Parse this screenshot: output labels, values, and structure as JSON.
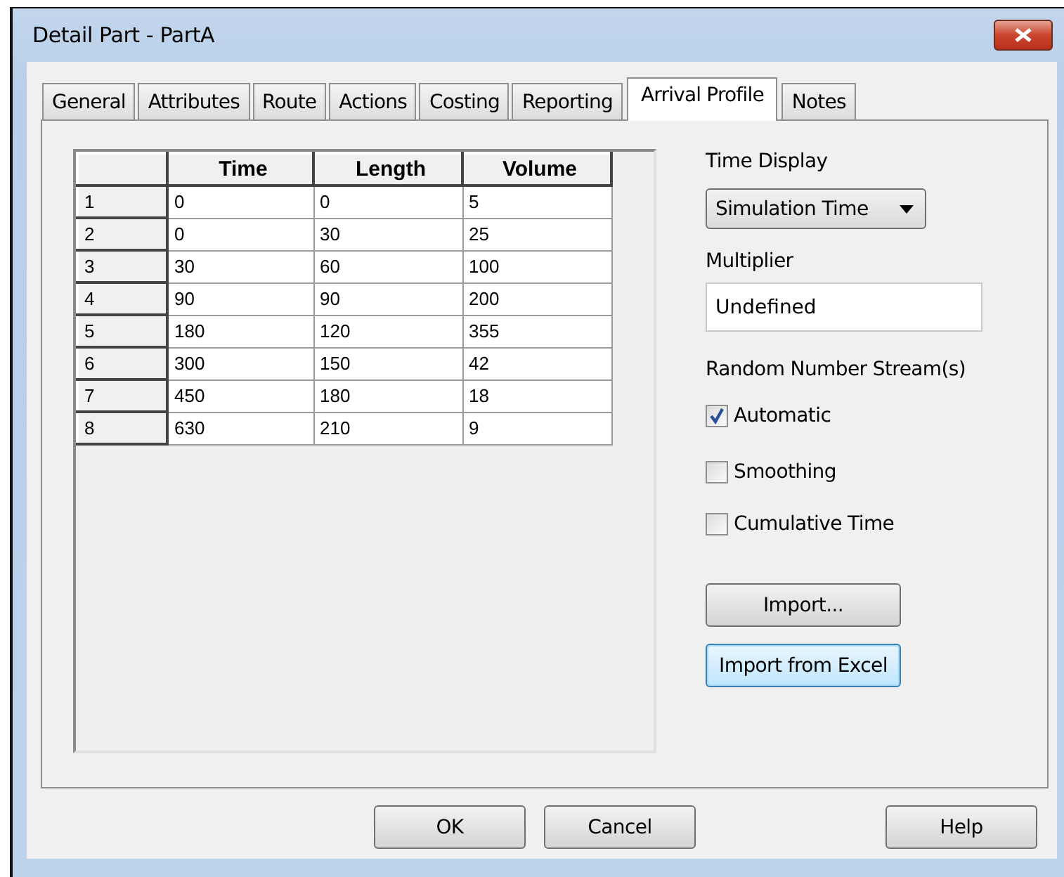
{
  "window": {
    "title": "Detail Part - PartA"
  },
  "tabs": [
    {
      "label": "General",
      "selected": false
    },
    {
      "label": "Attributes",
      "selected": false
    },
    {
      "label": "Route",
      "selected": false
    },
    {
      "label": "Actions",
      "selected": false
    },
    {
      "label": "Costing",
      "selected": false
    },
    {
      "label": "Reporting",
      "selected": false
    },
    {
      "label": "Arrival Profile",
      "selected": true
    },
    {
      "label": "Notes",
      "selected": false
    }
  ],
  "table": {
    "columns": [
      "Time",
      "Length",
      "Volume"
    ],
    "rows": [
      {
        "number": "1",
        "cells": [
          "0",
          "0",
          "5"
        ]
      },
      {
        "number": "2",
        "cells": [
          "0",
          "30",
          "25"
        ]
      },
      {
        "number": "3",
        "cells": [
          "30",
          "60",
          "100"
        ]
      },
      {
        "number": "4",
        "cells": [
          "90",
          "90",
          "200"
        ]
      },
      {
        "number": "5",
        "cells": [
          "180",
          "120",
          "355"
        ]
      },
      {
        "number": "6",
        "cells": [
          "300",
          "150",
          "42"
        ]
      },
      {
        "number": "7",
        "cells": [
          "450",
          "180",
          "18"
        ]
      },
      {
        "number": "8",
        "cells": [
          "630",
          "210",
          "9"
        ]
      }
    ]
  },
  "time_display": {
    "label": "Time Display",
    "value": "Simulation Time"
  },
  "multiplier": {
    "label": "Multiplier",
    "value": "Undefined"
  },
  "random_streams": {
    "label": "Random Number Stream(s)"
  },
  "checkboxes": [
    {
      "label": "Automatic",
      "checked": true
    },
    {
      "label": "Smoothing",
      "checked": false
    },
    {
      "label": "Cumulative Time",
      "checked": false
    }
  ],
  "panel_buttons": [
    {
      "label": "Import...",
      "focused": false
    },
    {
      "label": "Import from Excel",
      "focused": true
    }
  ],
  "buttons": [
    {
      "label": "OK"
    },
    {
      "label": "Cancel"
    },
    {
      "label": "Help"
    }
  ]
}
